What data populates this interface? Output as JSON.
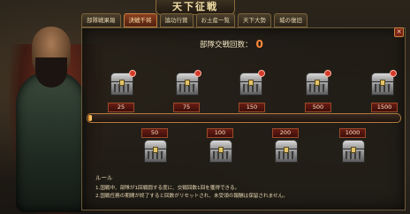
{
  "window_title": "天下征戦",
  "tabs": [
    {
      "label": "部隊戦果報"
    },
    {
      "label": "決戦千将"
    },
    {
      "label": "論功行賞"
    },
    {
      "label": "お土産一覧"
    },
    {
      "label": "天下大勢"
    },
    {
      "label": "城の復旧"
    }
  ],
  "active_tab": 1,
  "counter": {
    "label": "部隊交戦回数：",
    "value": "0"
  },
  "rewards_top": [
    {
      "label": "25"
    },
    {
      "label": "75"
    },
    {
      "label": "150"
    },
    {
      "label": "500"
    },
    {
      "label": "1500"
    }
  ],
  "rewards_bottom": [
    {
      "label": "50"
    },
    {
      "label": "100"
    },
    {
      "label": "200"
    },
    {
      "label": "1000"
    }
  ],
  "progress": {
    "value": 0
  },
  "rules": {
    "title": "ルール",
    "lines": [
      "1.国戦中、部隊が1回戦闘する度に、交戦回数1回を獲得できる。",
      "2.国戦任務の期間が終了すると回数がリセットされ、未受領の報酬は保留されません。"
    ]
  },
  "colors": {
    "accent": "#ff8a3a",
    "tab_active": "#8b3f1f",
    "label_bg": "#6a1c14"
  }
}
